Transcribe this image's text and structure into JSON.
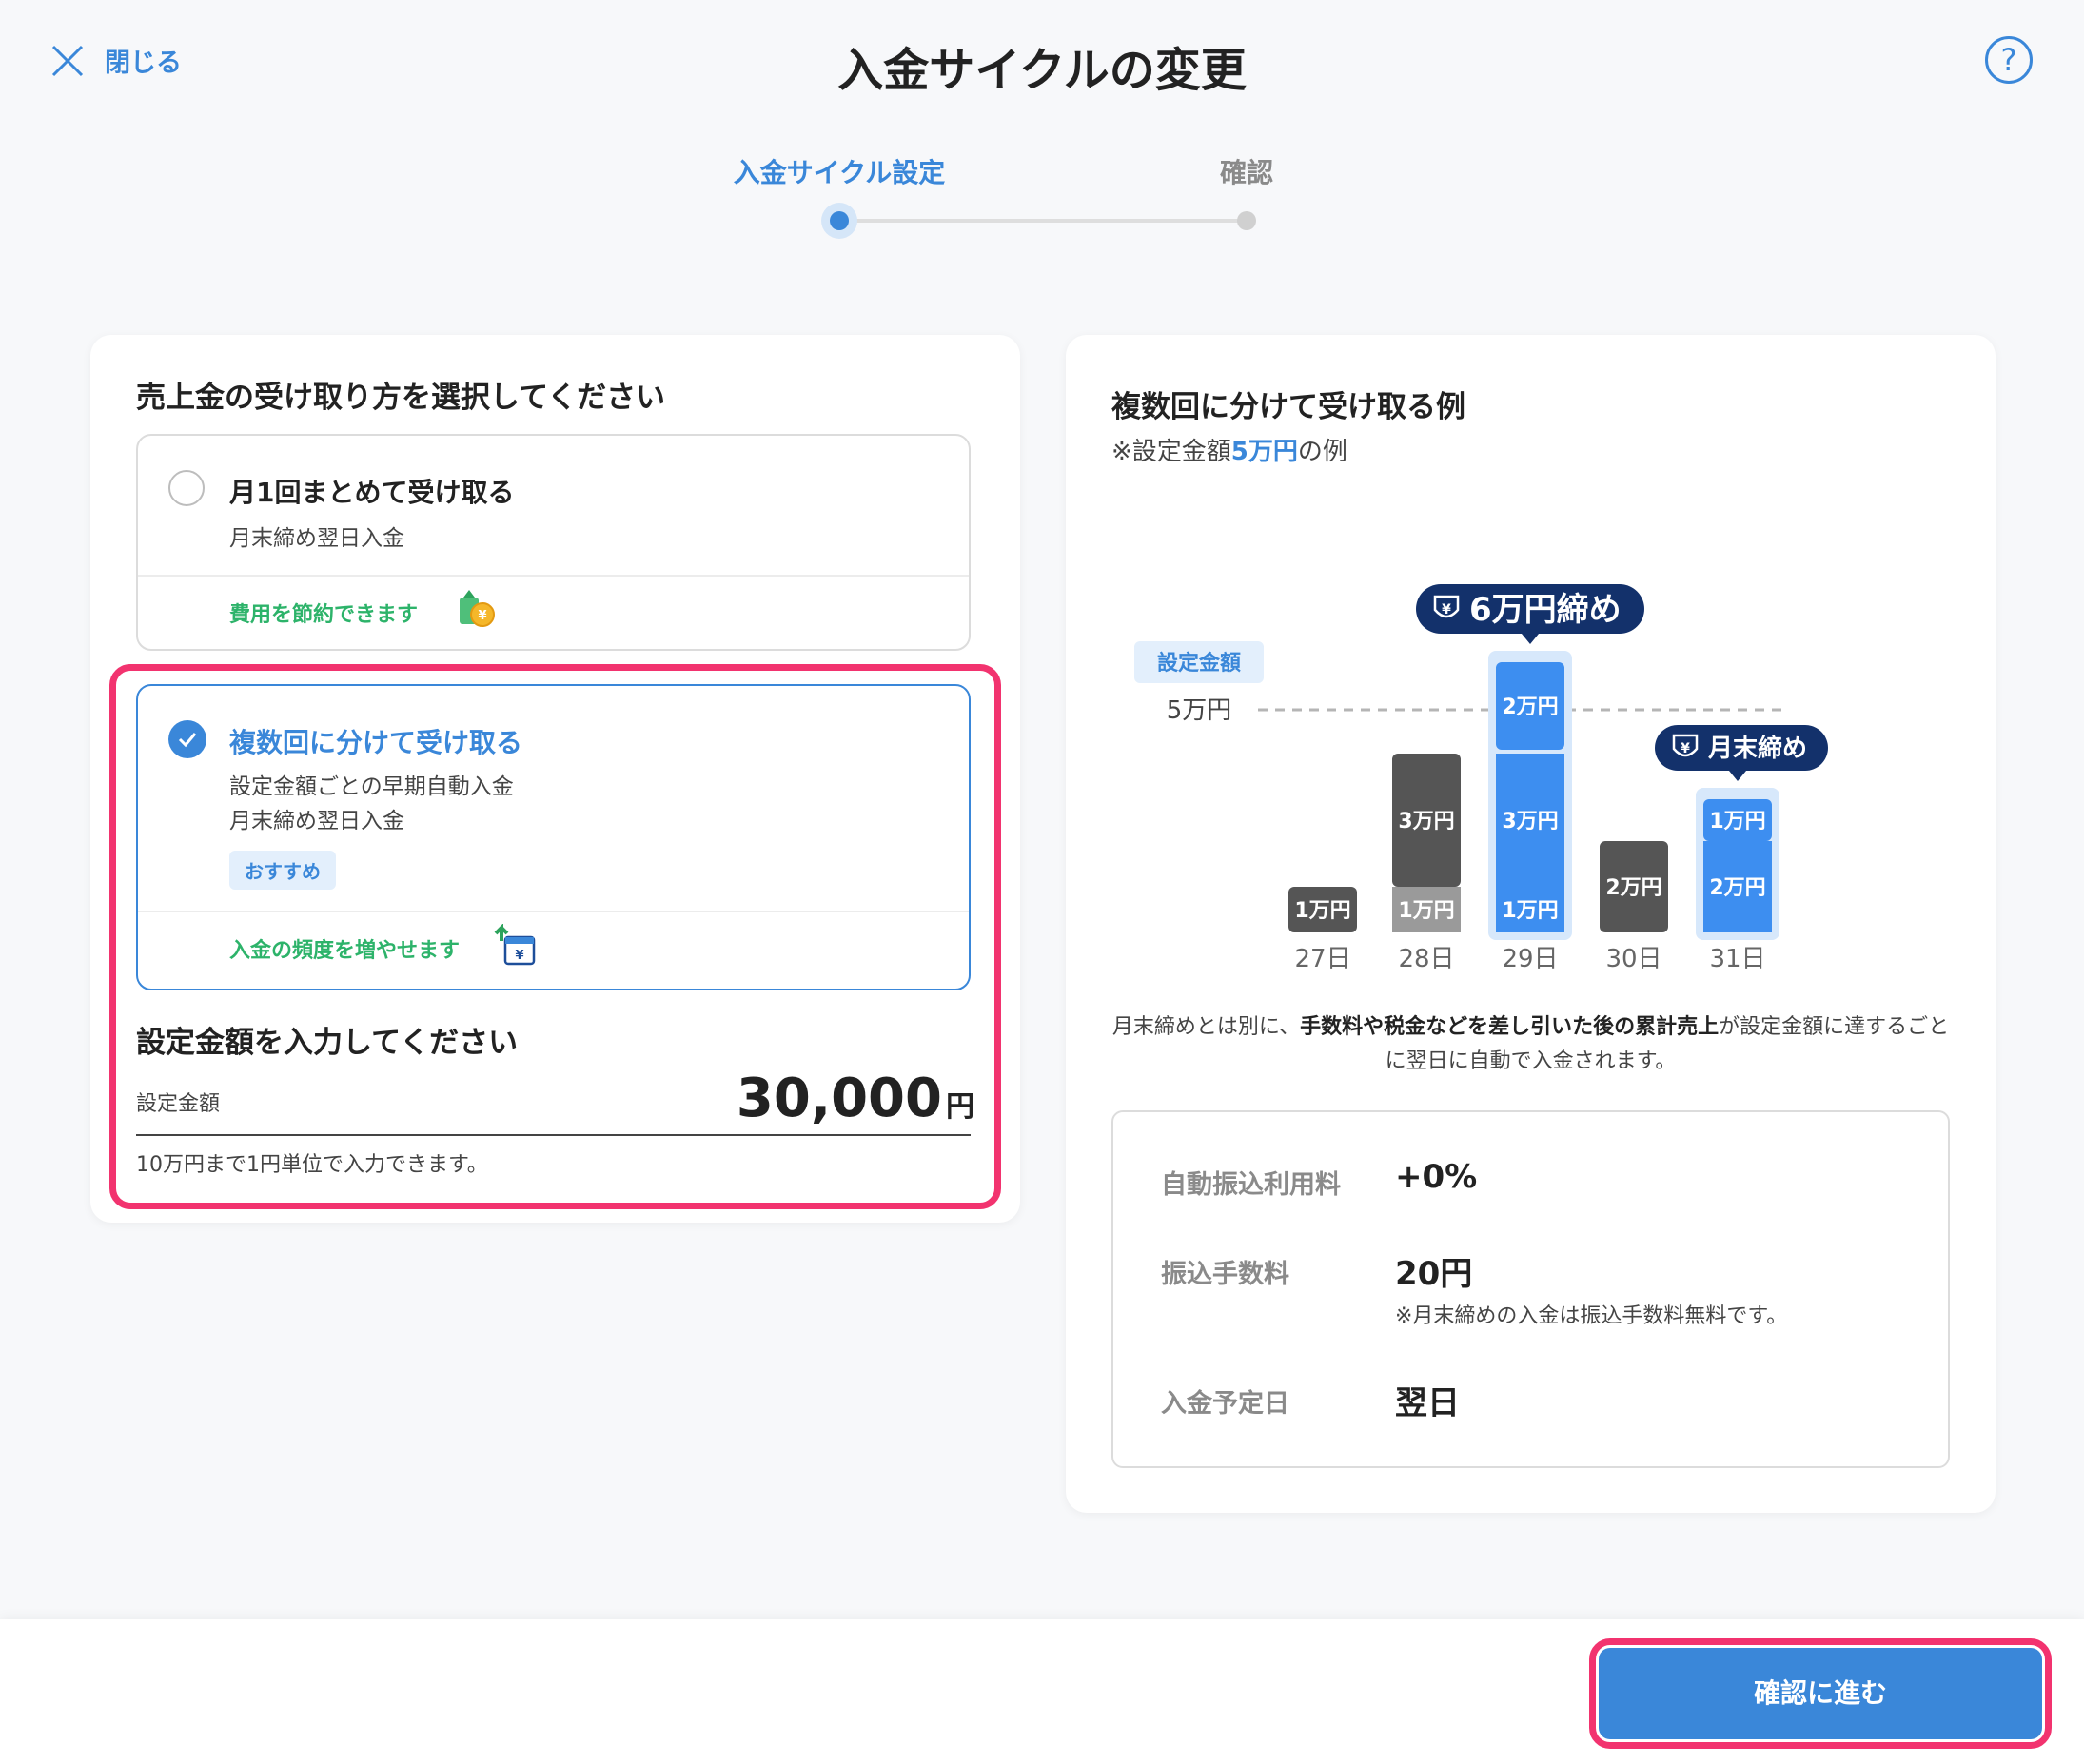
{
  "header": {
    "close_label": "閉じる",
    "title": "入金サイクルの変更",
    "help_label": "?"
  },
  "stepper": {
    "steps": [
      {
        "label": "入金サイクル設定",
        "active": true
      },
      {
        "label": "確認",
        "active": false
      }
    ]
  },
  "select": {
    "title": "売上金の受け取り方を選択してください",
    "options": [
      {
        "title": "月1回まとめて受け取る",
        "desc": [
          "月末締め翌日入金"
        ],
        "benefit": "費用を節約できます",
        "selected": false
      },
      {
        "title": "複数回に分けて受け取る",
        "desc": [
          "設定金額ごとの早期自動入金",
          "月末締め翌日入金"
        ],
        "tag": "おすすめ",
        "benefit": "入金の頻度を増やせます",
        "selected": true
      }
    ]
  },
  "amount": {
    "title": "設定金額を入力してください",
    "label": "設定金額",
    "value": "30,000",
    "unit": "円",
    "hint": "10万円まで1円単位で入力できます。"
  },
  "example": {
    "title": "複数回に分けて受け取る例",
    "sub_prefix": "※設定金額",
    "sub_highlight": "5万円",
    "sub_suffix": "の例",
    "explain_1": "月末締めとは別に、",
    "explain_bold": "手数料や税金などを差し引いた後の累計売上",
    "explain_2": "が設定金額に達するごとに翌日に自動で入金されます。"
  },
  "chart_data": {
    "type": "bar",
    "threshold_badge": "設定金額",
    "threshold_label": "5万円",
    "threshold": 5,
    "categories": [
      "27日",
      "28日",
      "29日",
      "30日",
      "31日"
    ],
    "stacks": [
      {
        "day": "27日",
        "segments": [
          {
            "value": 1,
            "label": "1万円",
            "kind": "carry"
          }
        ]
      },
      {
        "day": "28日",
        "segments": [
          {
            "value": 1,
            "label": "1万円",
            "kind": "carry-light"
          },
          {
            "value": 3,
            "label": "3万円",
            "kind": "carry"
          }
        ]
      },
      {
        "day": "29日",
        "segments": [
          {
            "value": 1,
            "label": "1万円",
            "kind": "paid"
          },
          {
            "value": 3,
            "label": "3万円",
            "kind": "paid"
          },
          {
            "value": 2,
            "label": "2万円",
            "kind": "paid"
          }
        ]
      },
      {
        "day": "30日",
        "segments": [
          {
            "value": 2,
            "label": "2万円",
            "kind": "carry"
          }
        ]
      },
      {
        "day": "31日",
        "segments": [
          {
            "value": 2,
            "label": "2万円",
            "kind": "paid"
          },
          {
            "value": 1,
            "label": "1万円",
            "kind": "paid"
          }
        ]
      }
    ],
    "callouts": [
      {
        "day": "29日",
        "text": "6万円締め",
        "icon": "¥"
      },
      {
        "day": "31日",
        "text": "月末締め",
        "icon": "¥"
      }
    ],
    "colors": {
      "carry": "#555555",
      "carry_light": "#9a9a9a",
      "paid": "#3d8ef0",
      "paid_glow": "#d7e8fb",
      "callout": "#13316b",
      "badge_bg": "#e3effc",
      "badge_text": "#3a87d9"
    }
  },
  "fees": [
    {
      "label": "自動振込利用料",
      "value": "+0%",
      "note": ""
    },
    {
      "label": "振込手数料",
      "value": "20円",
      "note": "※月末締めの入金は振込手数料無料です。"
    },
    {
      "label": "入金予定日",
      "value": "翌日",
      "note": ""
    }
  ],
  "footer": {
    "next_label": "確認に進む"
  },
  "colors": {
    "accent": "#3a87d9",
    "highlight": "#f2336f",
    "benefit": "#2db36a"
  }
}
